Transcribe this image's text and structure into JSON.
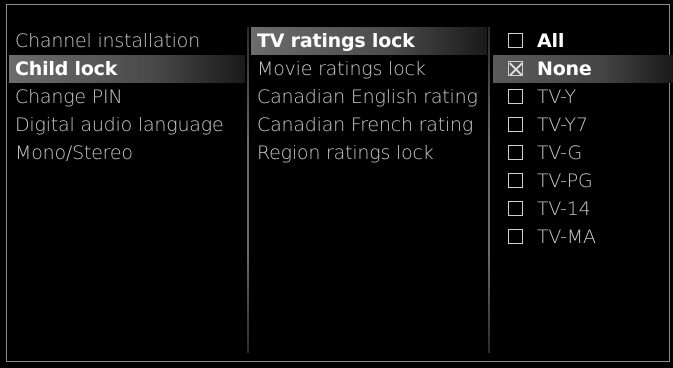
{
  "menu": {
    "items": [
      {
        "label": "Channel installation",
        "selected": false
      },
      {
        "label": "Child lock",
        "selected": true
      },
      {
        "label": "Change PIN",
        "selected": false
      },
      {
        "label": "Digital audio language",
        "selected": false
      },
      {
        "label": "Mono/Stereo",
        "selected": false
      }
    ]
  },
  "submenu": {
    "items": [
      {
        "label": "TV ratings lock",
        "selected": true
      },
      {
        "label": "Movie ratings lock",
        "selected": false
      },
      {
        "label": "Canadian English rating",
        "selected": false
      },
      {
        "label": "Canadian French rating",
        "selected": false
      },
      {
        "label": "Region ratings lock",
        "selected": false
      }
    ]
  },
  "ratings": {
    "items": [
      {
        "label": "All",
        "checked": false,
        "bold": true
      },
      {
        "label": "None",
        "checked": true,
        "bold": true
      },
      {
        "label": "TV-Y",
        "checked": false,
        "bold": false
      },
      {
        "label": "TV-Y7",
        "checked": false,
        "bold": false
      },
      {
        "label": "TV-G",
        "checked": false,
        "bold": false
      },
      {
        "label": "TV-PG",
        "checked": false,
        "bold": false
      },
      {
        "label": "TV-14",
        "checked": false,
        "bold": false
      },
      {
        "label": "TV-MA",
        "checked": false,
        "bold": false
      }
    ]
  }
}
